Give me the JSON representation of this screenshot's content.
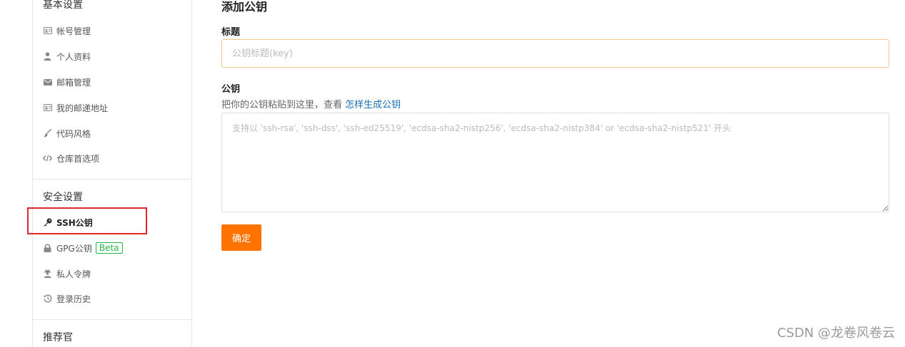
{
  "sidebar": {
    "basic_section": {
      "title": "基本设置",
      "items": [
        {
          "label": "帐号管理",
          "icon": "id-card-icon"
        },
        {
          "label": "个人资料",
          "icon": "user-icon"
        },
        {
          "label": "邮箱管理",
          "icon": "envelope-icon"
        },
        {
          "label": "我的邮递地址",
          "icon": "address-card-icon"
        },
        {
          "label": "代码风格",
          "icon": "brush-icon"
        },
        {
          "label": "仓库首选项",
          "icon": "code-icon"
        }
      ]
    },
    "security_section": {
      "title": "安全设置",
      "items": [
        {
          "label": "SSH公钥",
          "icon": "key-icon",
          "active": true
        },
        {
          "label": "GPG公钥",
          "icon": "lock-icon",
          "badge": "Beta"
        },
        {
          "label": "私人令牌",
          "icon": "user-secret-icon"
        },
        {
          "label": "登录历史",
          "icon": "history-icon"
        }
      ]
    },
    "referral_section": {
      "title": "推荐官"
    }
  },
  "main": {
    "title": "添加公钥",
    "title_field": {
      "label": "标题",
      "placeholder": "公钥标题(key)",
      "value": ""
    },
    "key_field": {
      "label": "公钥",
      "hint_text": "把你的公钥粘贴到这里，查看",
      "hint_link": "怎样生成公钥",
      "placeholder": "支持以 'ssh-rsa', 'ssh-dss', 'ssh-ed25519', 'ecdsa-sha2-nistp256', 'ecdsa-sha2-nistp384' or 'ecdsa-sha2-nistp521' 开头",
      "value": ""
    },
    "submit_label": "确定"
  },
  "watermark": "CSDN @龙卷风卷云",
  "colors": {
    "accent": "#fe7300",
    "link": "#1a6fb0",
    "beta_badge": "#21ba45",
    "highlight_box": "#e0282e",
    "input_focus_border": "#f5c78f"
  }
}
